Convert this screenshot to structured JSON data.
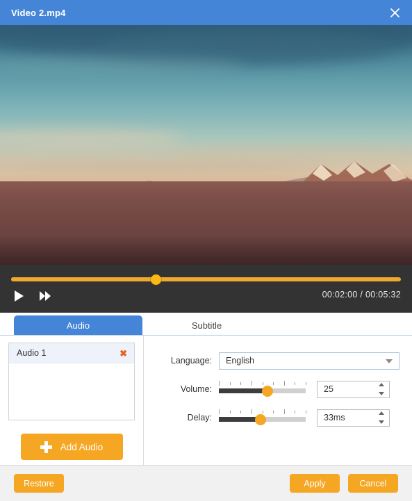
{
  "titlebar": {
    "title": "Video 2.mp4",
    "close_icon": "close-icon"
  },
  "preview": {
    "scene_description": "Sunset desert mountain landscape",
    "watermark": ""
  },
  "player": {
    "play_icon": "play-icon",
    "fast_forward_icon": "fast-forward-icon",
    "current_time": "00:02:00",
    "separator": "/",
    "total_time": "00:05:32",
    "timecode": "00:02:00 / 00:05:32",
    "progress_percent": 37,
    "track_color": "#f0a830",
    "handle_color": "#fcb813"
  },
  "tabs": [
    {
      "label": "Audio",
      "active": true
    },
    {
      "label": "Subtitle",
      "active": false
    }
  ],
  "audio_panel": {
    "list": [
      {
        "label": "Audio 1",
        "remove_icon": "close-icon"
      }
    ],
    "add_button": {
      "label": "Add Audio",
      "icon": "plus-icon"
    }
  },
  "settings": {
    "language": {
      "label": "Language:",
      "value": "English",
      "caret_icon": "chevron-down-icon"
    },
    "volume": {
      "label": "Volume:",
      "value": "25",
      "slider_percent": 56
    },
    "delay": {
      "label": "Delay:",
      "value": "33ms",
      "slider_percent": 48
    }
  },
  "footer": {
    "restore_label": "Restore",
    "apply_label": "Apply",
    "cancel_label": "Cancel"
  },
  "theme": {
    "accent_blue": "#4585d8",
    "accent_orange": "#f5a623",
    "timeline_orange": "#f0a830",
    "player_bg": "#333333",
    "delete_red": "#e8621a"
  }
}
